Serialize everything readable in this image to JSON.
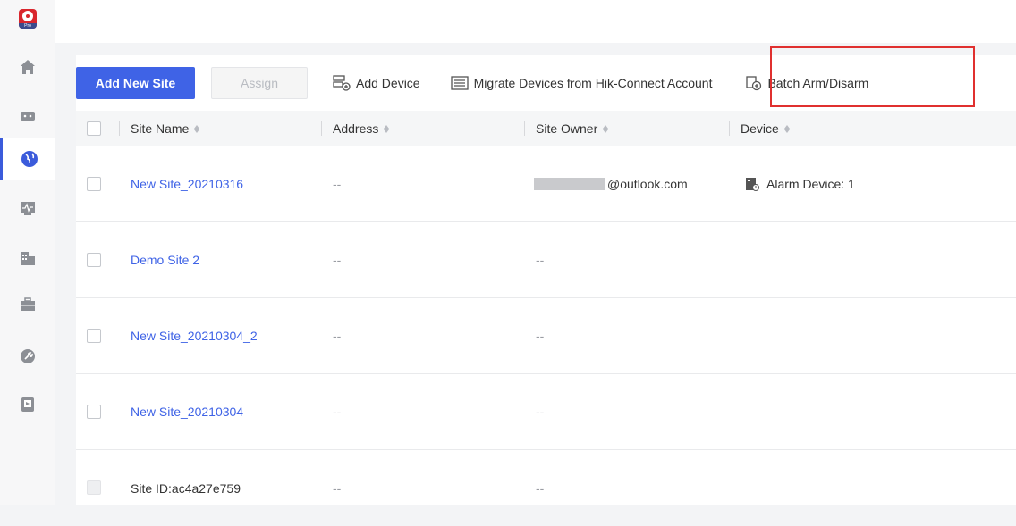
{
  "sidebar": {
    "logo_text": "Pro",
    "items": [
      {
        "icon": "home-icon"
      },
      {
        "icon": "device-icon"
      },
      {
        "icon": "globe-icon",
        "active": true
      },
      {
        "icon": "monitor-icon"
      },
      {
        "icon": "building-icon"
      },
      {
        "icon": "toolbox-icon"
      },
      {
        "icon": "wrench-icon"
      },
      {
        "icon": "book-icon"
      }
    ]
  },
  "toolbar": {
    "add_site": "Add New Site",
    "assign": "Assign",
    "add_device": "Add Device",
    "migrate": "Migrate Devices from Hik-Connect Account",
    "batch_arm": "Batch Arm/Disarm"
  },
  "table": {
    "columns": [
      "Site Name",
      "Address",
      "Site Owner",
      "Device"
    ],
    "rows": [
      {
        "name": "New Site_20210316",
        "address": "--",
        "owner_suffix": "@outlook.com",
        "device": "Alarm Device: 1"
      },
      {
        "name": "Demo Site 2",
        "address": "--",
        "owner": "--",
        "device": ""
      },
      {
        "name": "New Site_20210304_2",
        "address": "--",
        "owner": "--",
        "device": ""
      },
      {
        "name": "New Site_20210304",
        "address": "--",
        "owner": "--",
        "device": ""
      },
      {
        "name": "Site ID:ac4a27e759",
        "address": "--",
        "owner": "--",
        "device": ""
      }
    ]
  },
  "colors": {
    "accent": "#3f63e6",
    "highlight": "#e0302f",
    "logo": "#d9262d"
  }
}
